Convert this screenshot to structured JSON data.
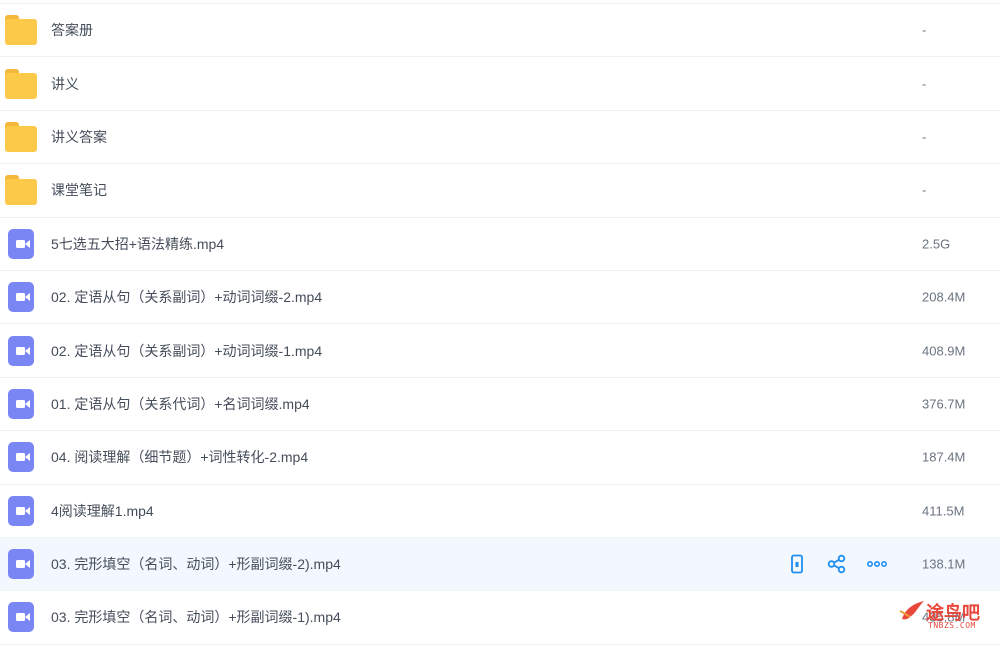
{
  "files": [
    {
      "type": "folder",
      "name": "答案册",
      "size": "-"
    },
    {
      "type": "folder",
      "name": "讲义",
      "size": "-"
    },
    {
      "type": "folder",
      "name": "讲义答案",
      "size": "-"
    },
    {
      "type": "folder",
      "name": "课堂笔记",
      "size": "-"
    },
    {
      "type": "video",
      "name": "5七选五大招+语法精练.mp4",
      "size": "2.5G"
    },
    {
      "type": "video",
      "name": "02. 定语从句（关系副词）+动词词缀-2.mp4",
      "size": "208.4M"
    },
    {
      "type": "video",
      "name": "02. 定语从句（关系副词）+动词词缀-1.mp4",
      "size": "408.9M"
    },
    {
      "type": "video",
      "name": "01. 定语从句（关系代词）+名词词缀.mp4",
      "size": "376.7M"
    },
    {
      "type": "video",
      "name": "04. 阅读理解（细节题）+词性转化-2.mp4",
      "size": "187.4M"
    },
    {
      "type": "video",
      "name": "4阅读理解1.mp4",
      "size": "411.5M"
    },
    {
      "type": "video",
      "name": "03. 完形填空（名词、动词）+形副词缀-2).mp4",
      "size": "138.1M"
    },
    {
      "type": "video",
      "name": "03. 完形填空（名词、动词）+形副词缀-1).mp4",
      "size": "435.8M"
    }
  ],
  "watermark": {
    "text": "途鸟吧",
    "sub": "TNBZS.COM"
  },
  "colors": {
    "folder": "#fcca48",
    "video": "#7b86f5",
    "action": "#1f8ef1",
    "hover_row": "#f2f8fe"
  }
}
